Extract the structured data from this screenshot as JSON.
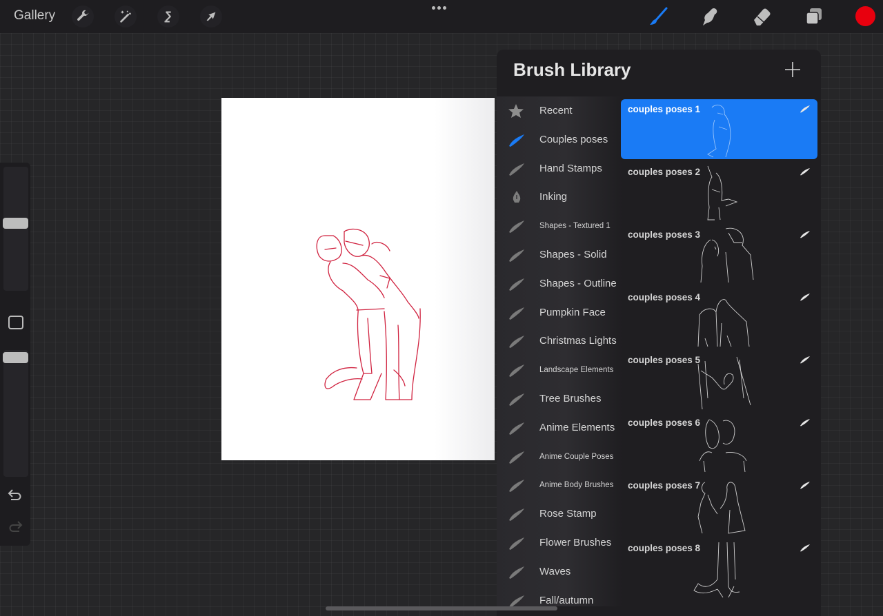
{
  "topbar": {
    "gallery_label": "Gallery",
    "left_tools": [
      {
        "name": "actions",
        "icon": "wrench-icon"
      },
      {
        "name": "adjustments",
        "icon": "magic-wand-icon"
      },
      {
        "name": "selection",
        "icon": "selection-s-icon"
      },
      {
        "name": "transform",
        "icon": "arrow-cursor-icon"
      }
    ],
    "more_icon": "ellipsis-icon",
    "right_tools": [
      {
        "name": "paint",
        "icon": "brush-icon",
        "active": true
      },
      {
        "name": "smudge",
        "icon": "smudge-finger-icon",
        "active": false
      },
      {
        "name": "erase",
        "icon": "eraser-icon",
        "active": false
      },
      {
        "name": "layers",
        "icon": "layers-icon",
        "active": false
      }
    ],
    "current_color": "#e8000e",
    "accent_color": "#1a7bf5"
  },
  "sidebar": {
    "brush_size_fraction": 0.5,
    "opacity_fraction": 1.0,
    "modify_icon": "square-icon",
    "undo_icon": "undo-arrow-icon",
    "redo_icon": "redo-arrow-icon"
  },
  "brush_library": {
    "title": "Brush Library",
    "add_icon": "plus-icon",
    "brush_sets": [
      {
        "label": "Recent",
        "icon": "star-icon",
        "size": "big"
      },
      {
        "label": "Couples poses",
        "icon": "brush-stroke-icon",
        "size": "big",
        "selected": true
      },
      {
        "label": "Hand Stamps",
        "icon": "brush-stroke-icon",
        "size": "big"
      },
      {
        "label": "Inking",
        "icon": "pen-nib-icon",
        "size": "big"
      },
      {
        "label": "Shapes - Textured 1",
        "icon": "brush-stroke-icon",
        "size": "small"
      },
      {
        "label": "Shapes - Solid",
        "icon": "brush-stroke-icon",
        "size": "big"
      },
      {
        "label": "Shapes - Outline",
        "icon": "brush-stroke-icon",
        "size": "big"
      },
      {
        "label": "Pumpkin Face",
        "icon": "brush-stroke-icon",
        "size": "big"
      },
      {
        "label": "Christmas Lights",
        "icon": "brush-stroke-icon",
        "size": "big"
      },
      {
        "label": "Landscape Elements",
        "icon": "brush-stroke-icon",
        "size": "small"
      },
      {
        "label": "Tree Brushes",
        "icon": "brush-stroke-icon",
        "size": "big"
      },
      {
        "label": "Anime Elements",
        "icon": "brush-stroke-icon",
        "size": "big"
      },
      {
        "label": "Anime Couple Poses",
        "icon": "brush-stroke-icon",
        "size": "small"
      },
      {
        "label": "Anime Body Brushes",
        "icon": "brush-stroke-icon",
        "size": "small"
      },
      {
        "label": "Rose Stamp",
        "icon": "brush-stroke-icon",
        "size": "big"
      },
      {
        "label": "Flower Brushes",
        "icon": "brush-stroke-icon",
        "size": "big"
      },
      {
        "label": "Waves",
        "icon": "brush-stroke-icon",
        "size": "big"
      },
      {
        "label": "Fall/autumn",
        "icon": "brush-stroke-icon",
        "size": "big"
      }
    ],
    "brushes": [
      {
        "name": "couples poses 1",
        "selected": true
      },
      {
        "name": "couples poses 2",
        "selected": false
      },
      {
        "name": "couples poses 3",
        "selected": false
      },
      {
        "name": "couples poses 4",
        "selected": false
      },
      {
        "name": "couples poses 5",
        "selected": false
      },
      {
        "name": "couples poses 6",
        "selected": false
      },
      {
        "name": "couples poses 7",
        "selected": false
      },
      {
        "name": "couples poses 8",
        "selected": false
      }
    ]
  },
  "canvas": {
    "drawing": "couple-embrace-line-art",
    "stroke_color": "#d0223f"
  }
}
